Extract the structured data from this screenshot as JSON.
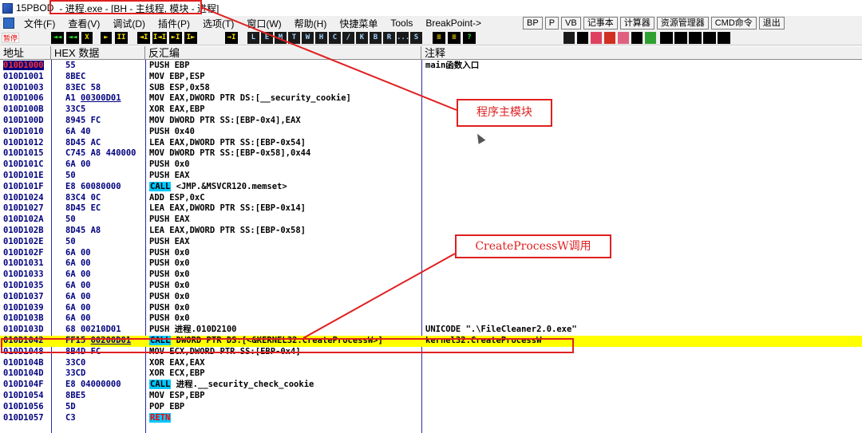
{
  "window": {
    "app_name": "15PBOD",
    "title": "- 进程.exe - [BH - 主线程, 模块 - 进程]"
  },
  "menu": {
    "items": [
      "文件(F)",
      "查看(V)",
      "调试(D)",
      "插件(P)",
      "选项(T)",
      "窗口(W)",
      "帮助(H)",
      "快捷菜单",
      "Tools",
      "BreakPoint->"
    ],
    "right_buttons": [
      "BP",
      "P",
      "VB",
      "记事本",
      "计算器",
      "资源管理器",
      "CMD命令",
      "退出"
    ]
  },
  "toolbar": {
    "status": "暂停",
    "buttons": [
      "◄◄",
      "◄◄",
      "X",
      "►",
      "II",
      "◄I",
      "I◄I",
      "►I",
      "I►",
      "→I",
      "L",
      "E",
      "M",
      "T",
      "W",
      "H",
      "C",
      "/",
      "K",
      "B",
      "R",
      "...",
      "S",
      "≡",
      "≡",
      "?"
    ]
  },
  "columns": {
    "address": "地址",
    "hex": "HEX 数据",
    "disasm": "反汇编",
    "comment": "注释"
  },
  "rows": [
    {
      "addr": "010D1000",
      "hex": "55",
      "asm": "PUSH EBP",
      "comment": "main函数入口"
    },
    {
      "addr": "010D1001",
      "hex": "8BEC",
      "asm": "MOV EBP,ESP",
      "comment": ""
    },
    {
      "addr": "010D1003",
      "hex": "83EC 58",
      "asm": "SUB ESP,0x58",
      "comment": ""
    },
    {
      "addr": "010D1006",
      "hex_pre": "A1 ",
      "hex_u": "00300D01",
      "asm": "MOV EAX,DWORD PTR DS:[__security_cookie]",
      "comment": ""
    },
    {
      "addr": "010D100B",
      "hex": "33C5",
      "asm": "XOR EAX,EBP",
      "comment": ""
    },
    {
      "addr": "010D100D",
      "hex": "8945 FC",
      "asm": "MOV DWORD PTR SS:[EBP-0x4],EAX",
      "comment": ""
    },
    {
      "addr": "010D1010",
      "hex": "6A 40",
      "asm": "PUSH 0x40",
      "comment": ""
    },
    {
      "addr": "010D1012",
      "hex": "8D45 AC",
      "asm": "LEA EAX,DWORD PTR SS:[EBP-0x54]",
      "comment": ""
    },
    {
      "addr": "010D1015",
      "hex": "C745 A8 440000",
      "asm": "MOV DWORD PTR SS:[EBP-0x58],0x44",
      "comment": ""
    },
    {
      "addr": "010D101C",
      "hex": "6A 00",
      "asm": "PUSH 0x0",
      "comment": ""
    },
    {
      "addr": "010D101E",
      "hex": "50",
      "asm": "PUSH EAX",
      "comment": ""
    },
    {
      "addr": "010D101F",
      "hex": "E8 60080000",
      "kw": "CALL",
      "asm": " <JMP.&MSVCR120.memset>",
      "comment": ""
    },
    {
      "addr": "010D1024",
      "hex": "83C4 0C",
      "asm": "ADD ESP,0xC",
      "comment": ""
    },
    {
      "addr": "010D1027",
      "hex": "8D45 EC",
      "asm": "LEA EAX,DWORD PTR SS:[EBP-0x14]",
      "comment": ""
    },
    {
      "addr": "010D102A",
      "hex": "50",
      "asm": "PUSH EAX",
      "comment": ""
    },
    {
      "addr": "010D102B",
      "hex": "8D45 A8",
      "asm": "LEA EAX,DWORD PTR SS:[EBP-0x58]",
      "comment": ""
    },
    {
      "addr": "010D102E",
      "hex": "50",
      "asm": "PUSH EAX",
      "comment": ""
    },
    {
      "addr": "010D102F",
      "hex": "6A 00",
      "asm": "PUSH 0x0",
      "comment": ""
    },
    {
      "addr": "010D1031",
      "hex": "6A 00",
      "asm": "PUSH 0x0",
      "comment": ""
    },
    {
      "addr": "010D1033",
      "hex": "6A 00",
      "asm": "PUSH 0x0",
      "comment": ""
    },
    {
      "addr": "010D1035",
      "hex": "6A 00",
      "asm": "PUSH 0x0",
      "comment": ""
    },
    {
      "addr": "010D1037",
      "hex": "6A 00",
      "asm": "PUSH 0x0",
      "comment": ""
    },
    {
      "addr": "010D1039",
      "hex": "6A 00",
      "asm": "PUSH 0x0",
      "comment": ""
    },
    {
      "addr": "010D103B",
      "hex": "6A 00",
      "asm": "PUSH 0x0",
      "comment": ""
    },
    {
      "addr": "010D103D",
      "hex": "68 00210D01",
      "asm": "PUSH 进程.010D2100",
      "comment": "UNICODE \".\\FileCleaner2.0.exe\""
    },
    {
      "addr": "010D1042",
      "hex_pre": "FF15 ",
      "hex_u": "00200D01",
      "kw": "CALL",
      "asm": " DWORD PTR DS:[<&KERNEL32.CreateProcessW>]",
      "comment": "kernel32.CreateProcessW"
    },
    {
      "addr": "010D1048",
      "hex": "8B4D FC",
      "asm": "MOV ECX,DWORD PTR SS:[EBP-0x4]",
      "comment": ""
    },
    {
      "addr": "010D104B",
      "hex": "33C0",
      "asm": "XOR EAX,EAX",
      "comment": ""
    },
    {
      "addr": "010D104D",
      "hex": "33CD",
      "asm": "XOR ECX,EBP",
      "comment": ""
    },
    {
      "addr": "010D104F",
      "hex": "E8 04000000",
      "kw": "CALL",
      "asm": " 进程.__security_check_cookie",
      "comment": ""
    },
    {
      "addr": "010D1054",
      "hex": "8BE5",
      "asm": "MOV ESP,EBP",
      "comment": ""
    },
    {
      "addr": "010D1056",
      "hex": "5D",
      "asm": "POP EBP",
      "comment": ""
    },
    {
      "addr": "010D1057",
      "hex": "C3",
      "kw": "RETN",
      "asm": "",
      "comment": ""
    }
  ],
  "annotations": {
    "module_label": "程序主模块",
    "call_label": "CreateProcessW调用"
  },
  "colors": {
    "highlight": "#ffff00",
    "annotation": "#e02020",
    "keyword_bg": "#00c8ff"
  }
}
